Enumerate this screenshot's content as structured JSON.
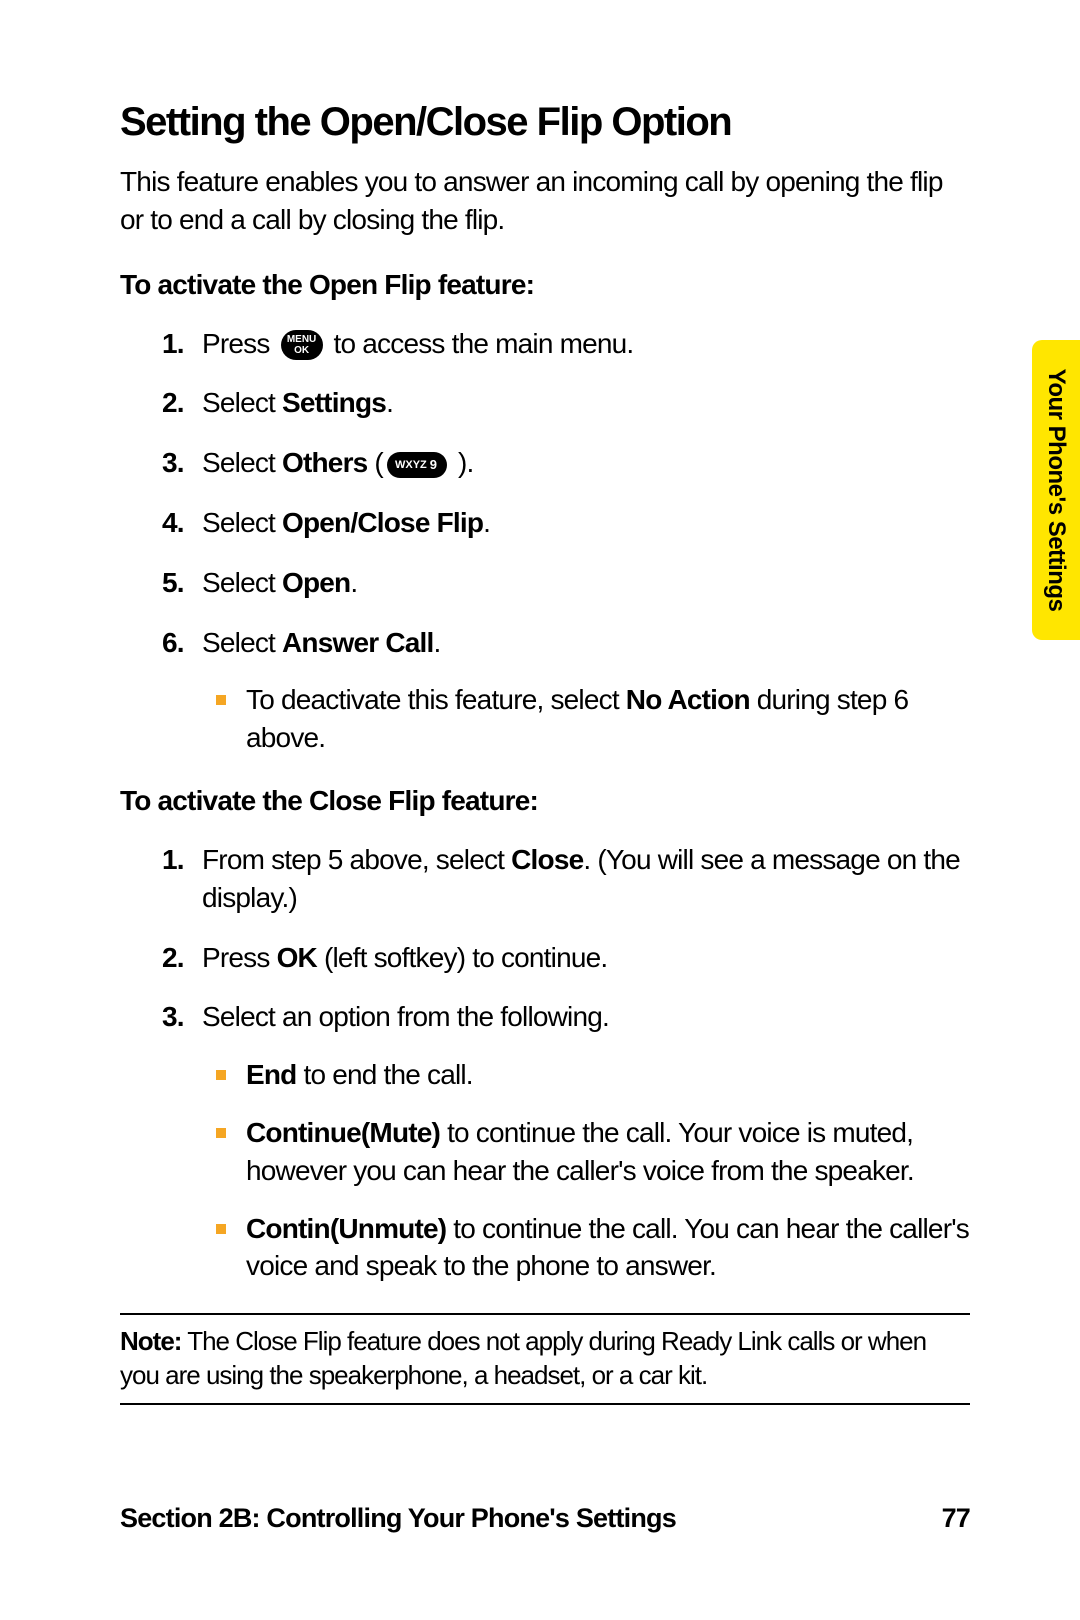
{
  "heading": "Setting the Open/Close Flip Option",
  "intro": "This feature enables you to answer an incoming call by opening the flip or to end a call by closing the flip.",
  "section1_heading": "To activate the Open Flip feature:",
  "open_steps": {
    "s1_a": "Press ",
    "s1_b": " to access the main menu.",
    "s2_a": "Select ",
    "s2_b": "Settings",
    "s2_c": ".",
    "s3_a": "Select ",
    "s3_b": "Others",
    "s3_c": " (",
    "s3_d": " ).",
    "s4_a": "Select ",
    "s4_b": "Open/Close Flip",
    "s4_c": ".",
    "s5_a": "Select ",
    "s5_b": "Open",
    "s5_c": ".",
    "s6_a": "Select ",
    "s6_b": "Answer Call",
    "s6_c": ".",
    "s6_bullet_a": "To deactivate this feature, select ",
    "s6_bullet_b": "No Action",
    "s6_bullet_c": " during step 6 above."
  },
  "section2_heading": "To activate the Close Flip feature:",
  "close_steps": {
    "s1_a": "From step 5 above, select ",
    "s1_b": "Close",
    "s1_c": ". (You will see a message on the display.)",
    "s2_a": "Press ",
    "s2_b": "OK",
    "s2_c": " (left softkey) to continue.",
    "s3": "Select an option from the following.",
    "b1_a": "End",
    "b1_b": " to end the call.",
    "b2_a": "Continue(Mute)",
    "b2_b": " to continue the call. Your voice is muted, however you can hear the caller's voice from the speaker.",
    "b3_a": "Contin(Unmute)",
    "b3_b": " to continue the call. You can hear the caller's voice and speak to the phone to answer."
  },
  "note_label": "Note:",
  "note_text": " The Close Flip feature does not apply during Ready Link calls or when you are using the speakerphone, a headset, or a car kit.",
  "footer_section": "Section 2B: Controlling Your Phone's Settings",
  "footer_page": "77",
  "side_tab": "Your Phone's Settings",
  "icons": {
    "menu_label": "MENU\nOK",
    "key9_wxyz": "WXYZ",
    "key9_num": "9"
  },
  "nums": {
    "n1": "1.",
    "n2": "2.",
    "n3": "3.",
    "n4": "4.",
    "n5": "5.",
    "n6": "6."
  }
}
